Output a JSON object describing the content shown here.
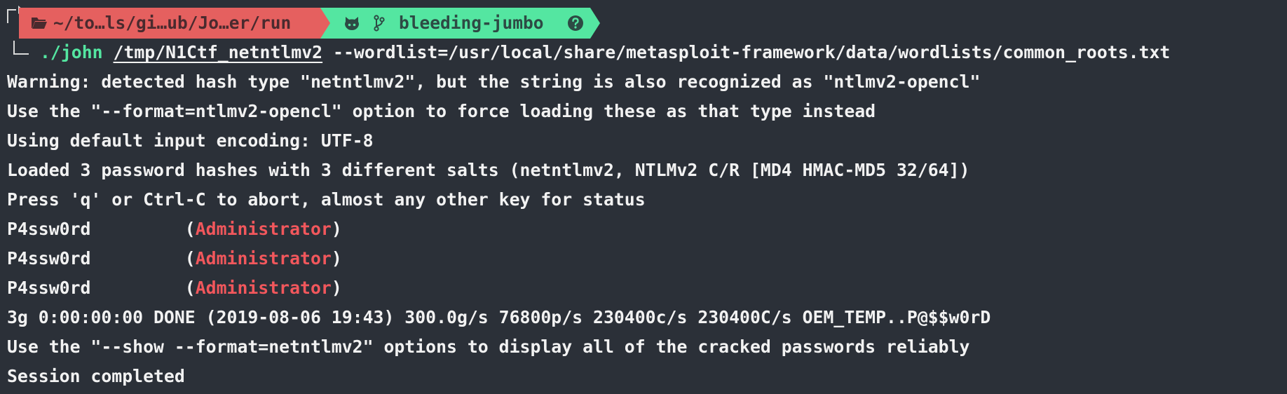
{
  "prompt": {
    "path": "~/to…ls/gi…ub/Jo…er/run",
    "branch": "bleeding-jumbo",
    "icons": [
      "folder-icon",
      "github-icon",
      "git-branch-icon",
      "help-icon"
    ],
    "colors": {
      "background": "#2b3038",
      "path_segment": "#e5605f",
      "git_segment": "#54e6a1",
      "highlight_red": "#f2575c"
    }
  },
  "command": {
    "executable": "./john",
    "hash_file": "/tmp/N1Ctf_netntlmv2",
    "options": " --wordlist=/usr/local/share/metasploit-framework/data/wordlists/common_roots.txt"
  },
  "output": {
    "warning": "Warning: detected hash type \"netntlmv2\", but the string is also recognized as \"ntlmv2-opencl\"",
    "use_format": "Use the \"--format=ntlmv2-opencl\" option to force loading these as that type instead",
    "encoding": "Using default input encoding: UTF-8",
    "loaded": "Loaded 3 password hashes with 3 different salts (netntlmv2, NTLMv2 C/R [MD4 HMAC-MD5 32/64])",
    "press": "Press 'q' or Ctrl-C to abort, almost any other key for status",
    "cracked": [
      {
        "password": "P4ssw0rd",
        "user": "Administrator"
      },
      {
        "password": "P4ssw0rd",
        "user": "Administrator"
      },
      {
        "password": "P4ssw0rd",
        "user": "Administrator"
      }
    ],
    "status": "3g 0:00:00:00 DONE (2019-08-06 19:43) 300.0g/s 76800p/s 230400c/s 230400C/s OEM_TEMP..P@$$w0rD",
    "show_hint": "Use the \"--show --format=netntlmv2\" options to display all of the cracked passwords reliably",
    "session": "Session completed"
  }
}
